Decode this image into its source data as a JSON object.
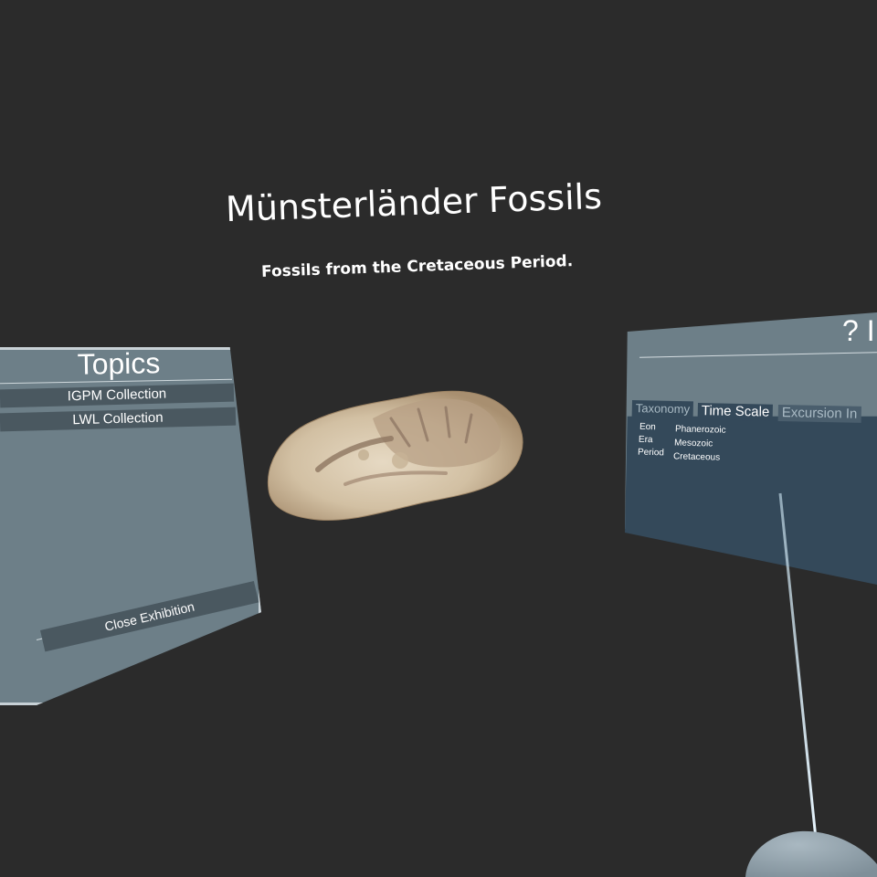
{
  "exhibit": {
    "title": "Münsterländer Fossils",
    "subtitle": "Fossils from the Cretaceous Period."
  },
  "topics": {
    "title": "Topics",
    "items": [
      {
        "label": "IGPM Collection"
      },
      {
        "label": "LWL Collection"
      }
    ],
    "close_label": "Close Exhibition"
  },
  "info_panel": {
    "help_label": "? I",
    "tabs": [
      {
        "label": "Taxonomy",
        "active": false
      },
      {
        "label": "Time Scale",
        "active": true
      },
      {
        "label": "Excursion In",
        "active": false
      }
    ],
    "time_scale": [
      {
        "key": "Eon",
        "value": "Phanerozoic"
      },
      {
        "key": "Era",
        "value": "Mesozoic"
      },
      {
        "key": "Period",
        "value": "Cretaceous"
      }
    ]
  },
  "colors": {
    "background": "#2b2b2b",
    "panel": "#6d7f88",
    "panel_dark": "#34495a",
    "button": "#4a5860",
    "ray": "#cfe8f5"
  }
}
